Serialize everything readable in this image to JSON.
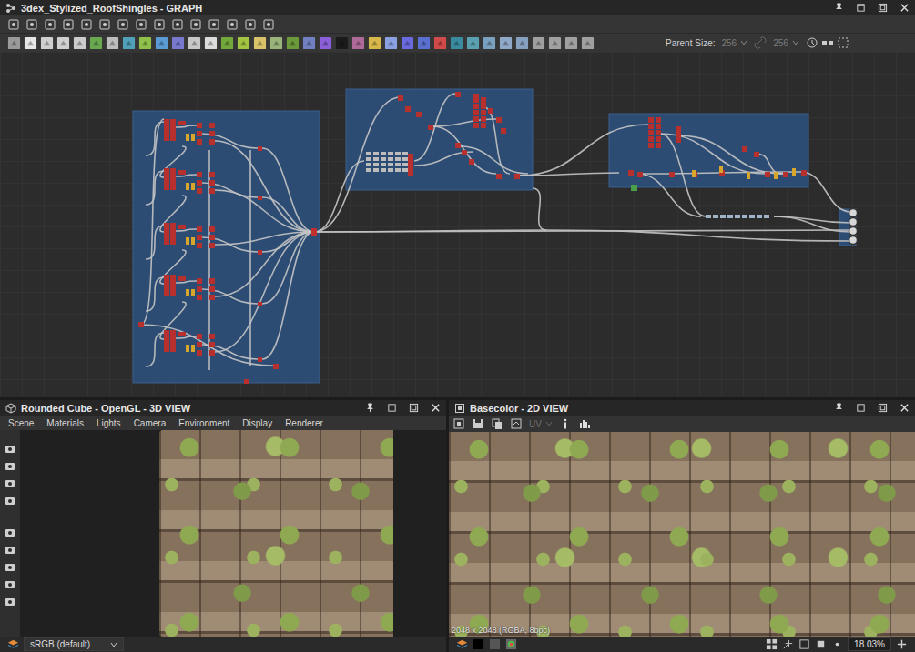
{
  "graph_window": {
    "title": "3dex_Stylized_RoofShingles - GRAPH",
    "parent_size_label": "Parent Size:",
    "parent_size_width": "256",
    "parent_size_height": "256"
  },
  "view_3d": {
    "title": "Rounded Cube - OpenGL - 3D VIEW",
    "menus": [
      "Scene",
      "Materials",
      "Lights",
      "Camera",
      "Environment",
      "Display",
      "Renderer"
    ],
    "color_space": "sRGB (default)"
  },
  "view_2d": {
    "title": "Basecolor - 2D VIEW",
    "uv_label": "UV",
    "image_info": "2048 x 2048 (RGBA, 8bpc)",
    "zoom": "18.03%"
  }
}
